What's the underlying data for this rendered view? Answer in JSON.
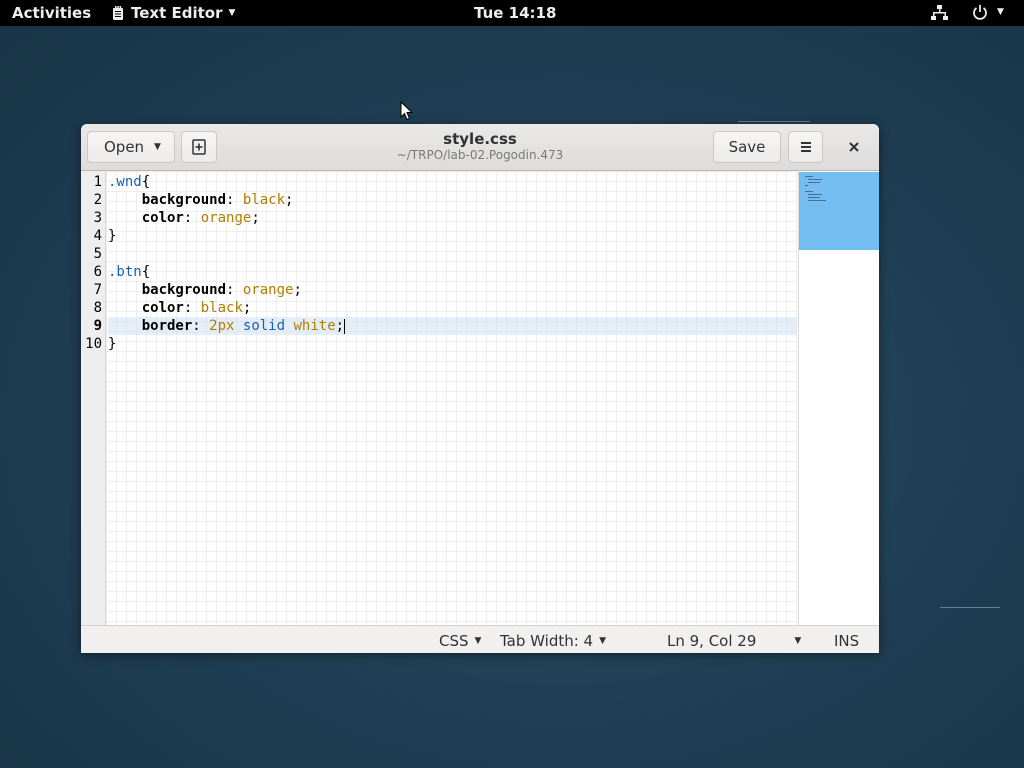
{
  "topbar": {
    "activities": "Activities",
    "app_name": "Text Editor",
    "clock": "Tue 14:18"
  },
  "window": {
    "title": "style.css",
    "subtitle": "~/TRPO/lab-02.Pogodin.473",
    "open_label": "Open",
    "save_label": "Save"
  },
  "editor": {
    "current_line": 9,
    "lines": [
      {
        "n": "1",
        "tokens": [
          {
            "t": ".wnd",
            "c": "sel"
          },
          {
            "t": "{",
            "c": ""
          }
        ]
      },
      {
        "n": "2",
        "tokens": [
          {
            "t": "    ",
            "c": ""
          },
          {
            "t": "background",
            "c": "prop"
          },
          {
            "t": ": ",
            "c": ""
          },
          {
            "t": "black",
            "c": "val"
          },
          {
            "t": ";",
            "c": ""
          }
        ]
      },
      {
        "n": "3",
        "tokens": [
          {
            "t": "    ",
            "c": ""
          },
          {
            "t": "color",
            "c": "prop"
          },
          {
            "t": ": ",
            "c": ""
          },
          {
            "t": "orange",
            "c": "val"
          },
          {
            "t": ";",
            "c": ""
          }
        ]
      },
      {
        "n": "4",
        "tokens": [
          {
            "t": "}",
            "c": ""
          }
        ]
      },
      {
        "n": "5",
        "tokens": []
      },
      {
        "n": "6",
        "tokens": [
          {
            "t": ".btn",
            "c": "sel"
          },
          {
            "t": "{",
            "c": ""
          }
        ]
      },
      {
        "n": "7",
        "tokens": [
          {
            "t": "    ",
            "c": ""
          },
          {
            "t": "background",
            "c": "prop"
          },
          {
            "t": ": ",
            "c": ""
          },
          {
            "t": "orange",
            "c": "val"
          },
          {
            "t": ";",
            "c": ""
          }
        ]
      },
      {
        "n": "8",
        "tokens": [
          {
            "t": "    ",
            "c": ""
          },
          {
            "t": "color",
            "c": "prop"
          },
          {
            "t": ": ",
            "c": ""
          },
          {
            "t": "black",
            "c": "val"
          },
          {
            "t": ";",
            "c": ""
          }
        ]
      },
      {
        "n": "9",
        "tokens": [
          {
            "t": "    ",
            "c": ""
          },
          {
            "t": "border",
            "c": "prop"
          },
          {
            "t": ": ",
            "c": ""
          },
          {
            "t": "2px",
            "c": "val"
          },
          {
            "t": " ",
            "c": ""
          },
          {
            "t": "solid",
            "c": "valb"
          },
          {
            "t": " ",
            "c": ""
          },
          {
            "t": "white",
            "c": "val"
          },
          {
            "t": ";",
            "c": ""
          }
        ]
      },
      {
        "n": "10",
        "tokens": [
          {
            "t": "}",
            "c": ""
          }
        ]
      }
    ]
  },
  "statusbar": {
    "language": "CSS",
    "tab_width": "Tab Width: 4",
    "position": "Ln 9, Col 29",
    "mode": "INS"
  },
  "colors": {
    "selector": "#1a5fb4",
    "value": "#b07d00",
    "minimap_view": "#74bdf0",
    "topbar": "#000000"
  },
  "icons": {
    "app": "text-editor-icon",
    "network": "network-icon",
    "power": "power-icon",
    "new_document": "new-document-icon",
    "menu": "hamburger-menu-icon",
    "close": "close-icon"
  }
}
